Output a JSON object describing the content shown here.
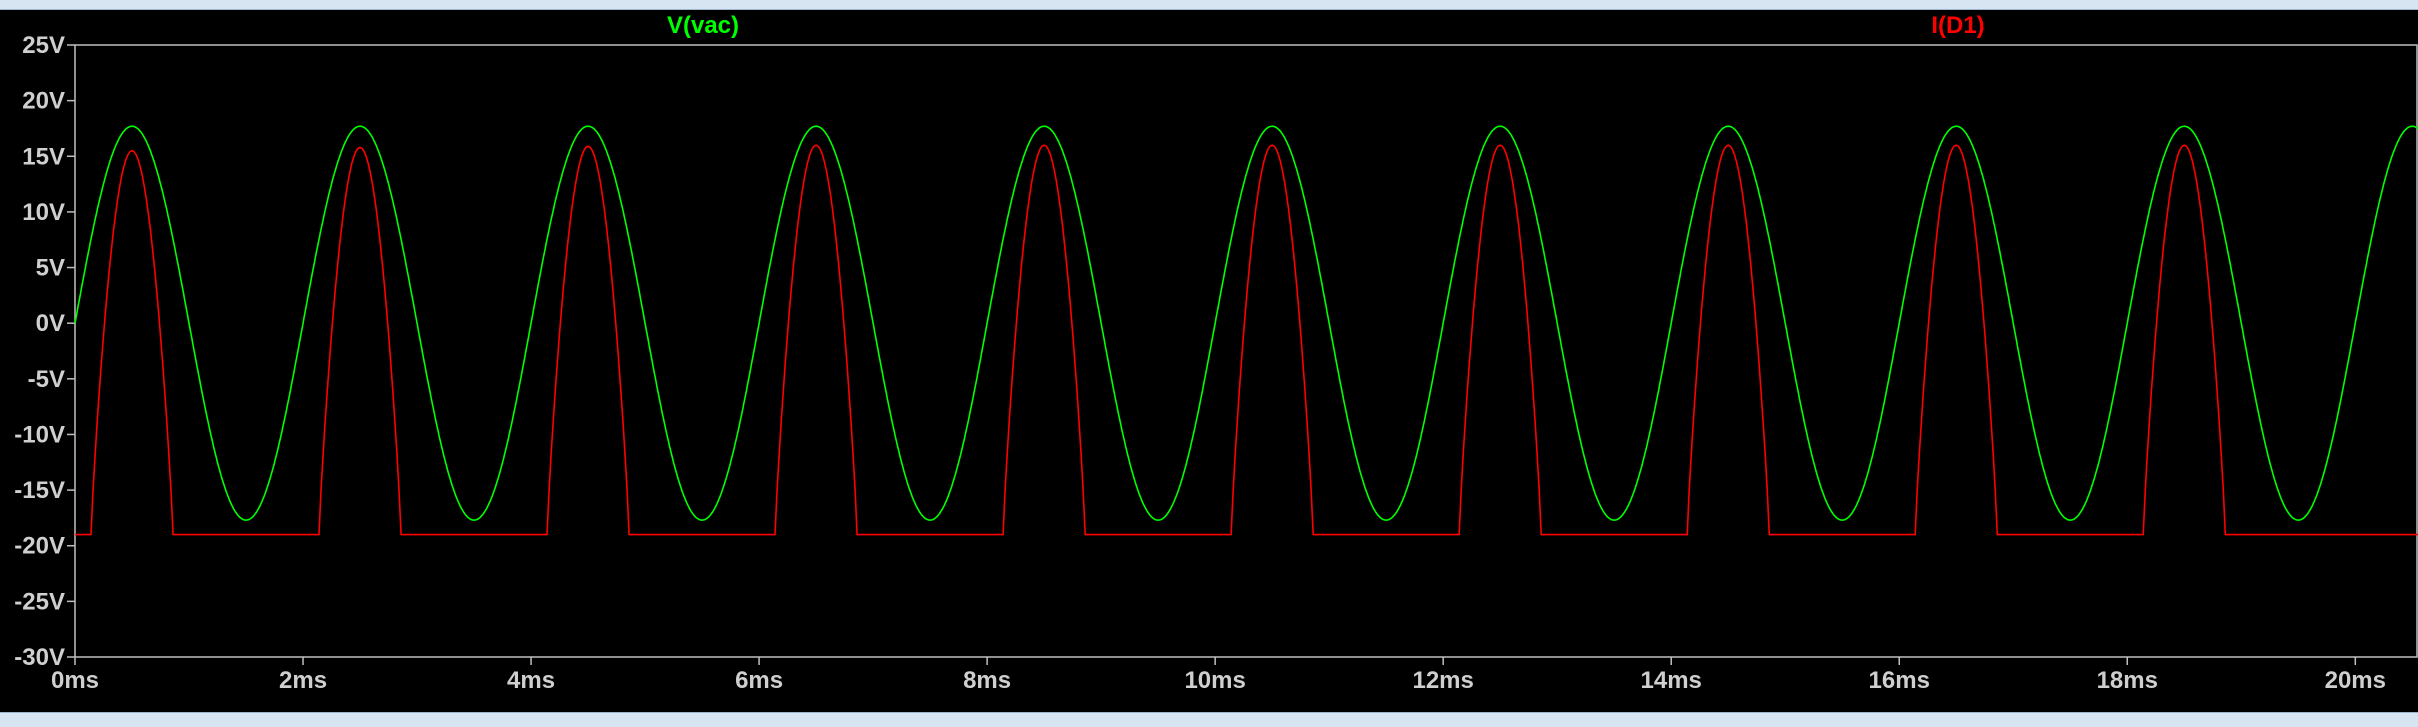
{
  "window": {
    "title_fragment": ""
  },
  "chart_data": {
    "type": "line",
    "title": "",
    "xlabel": "",
    "ylabel": "",
    "x_unit": "ms",
    "y_unit": "V",
    "xlim": [
      0,
      20.55
    ],
    "ylim": [
      -30,
      25
    ],
    "grid": false,
    "x_ticks": [
      "0ms",
      "2ms",
      "4ms",
      "6ms",
      "8ms",
      "10ms",
      "12ms",
      "14ms",
      "16ms",
      "18ms",
      "20ms"
    ],
    "y_ticks": [
      "25V",
      "20V",
      "15V",
      "10V",
      "5V",
      "0V",
      "-5V",
      "-10V",
      "-15V",
      "-20V",
      "-25V",
      "-30V"
    ],
    "x_tick_values": [
      0,
      2,
      4,
      6,
      8,
      10,
      12,
      14,
      16,
      18,
      20
    ],
    "y_tick_values": [
      25,
      20,
      15,
      10,
      5,
      0,
      -5,
      -10,
      -15,
      -20,
      -25,
      -30
    ],
    "series": [
      {
        "name": "V(vac)",
        "color": "#00ff00",
        "shape": "sine",
        "amplitude": 17.7,
        "offset": 0,
        "period_ms": 2.0,
        "phase_start_ms": 0
      },
      {
        "name": "I(D1)",
        "color": "#ff0000",
        "shape": "pulse",
        "baseline": -19,
        "peaks": [
          {
            "x": 0.5,
            "y": 15.5
          },
          {
            "x": 2.5,
            "y": 15.8
          },
          {
            "x": 4.5,
            "y": 15.9
          },
          {
            "x": 6.5,
            "y": 16.0
          },
          {
            "x": 8.5,
            "y": 16.0
          },
          {
            "x": 10.5,
            "y": 16.0
          },
          {
            "x": 12.5,
            "y": 16.0
          },
          {
            "x": 14.5,
            "y": 16.0
          },
          {
            "x": 16.5,
            "y": 16.0
          },
          {
            "x": 18.5,
            "y": 16.0
          }
        ],
        "pulse_start_offset_ms": -0.36,
        "pulse_end_offset_ms": 0.36
      }
    ]
  }
}
